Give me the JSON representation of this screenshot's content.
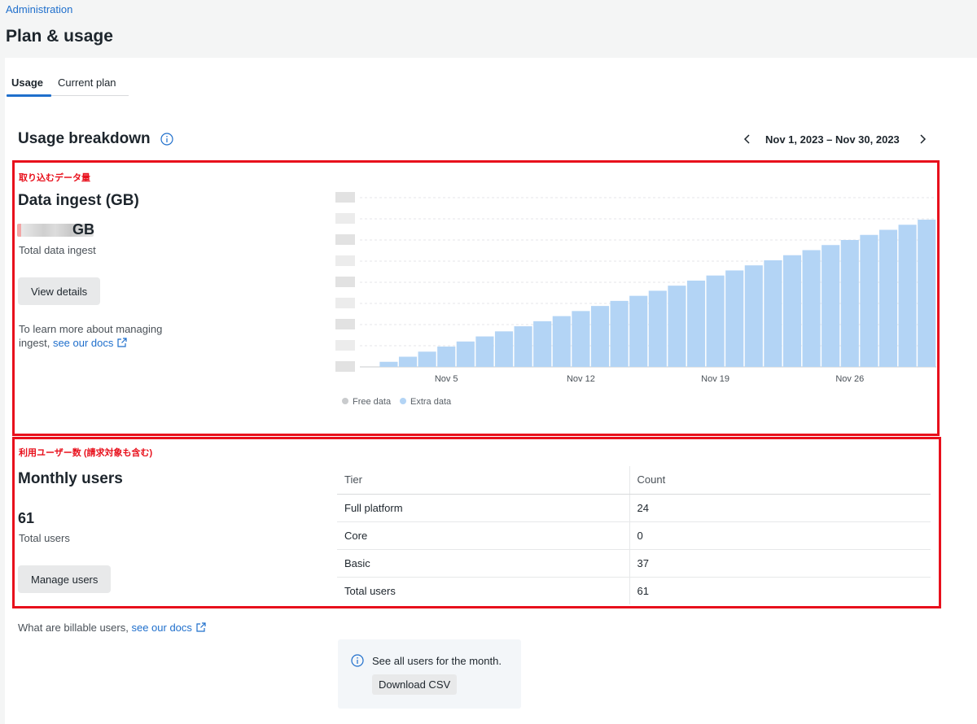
{
  "breadcrumb": "Administration",
  "page_title": "Plan & usage",
  "tabs": [
    {
      "label": "Usage",
      "active": true
    },
    {
      "label": "Current plan",
      "active": false
    }
  ],
  "breakdown": {
    "title": "Usage breakdown",
    "date_range": "Nov 1, 2023 – Nov 30, 2023"
  },
  "annotations": {
    "ingest_note": "取り込むデータ量",
    "users_note": "利用ユーザー数 (請求対象も含む)"
  },
  "ingest": {
    "title": "Data ingest (GB)",
    "value": "",
    "value_redacted": true,
    "unit": "GB",
    "caption": "Total data ingest",
    "button": "View details",
    "help_text": "To learn more about managing ingest,",
    "help_link": "see our docs"
  },
  "chart_data": {
    "type": "bar",
    "categories": [
      "Nov 1",
      "Nov 2",
      "Nov 3",
      "Nov 4",
      "Nov 5",
      "Nov 6",
      "Nov 7",
      "Nov 8",
      "Nov 9",
      "Nov 10",
      "Nov 11",
      "Nov 12",
      "Nov 13",
      "Nov 14",
      "Nov 15",
      "Nov 16",
      "Nov 17",
      "Nov 18",
      "Nov 19",
      "Nov 20",
      "Nov 21",
      "Nov 22",
      "Nov 23",
      "Nov 24",
      "Nov 25",
      "Nov 26",
      "Nov 27",
      "Nov 28",
      "Nov 29",
      "Nov 30"
    ],
    "x_tick_labels": [
      "Nov 5",
      "Nov 12",
      "Nov 19",
      "Nov 26"
    ],
    "series": [
      {
        "name": "Free data",
        "color": "#c9cbcd",
        "values": [
          0,
          0,
          0,
          0,
          0,
          0,
          0,
          0,
          0,
          0,
          0,
          0,
          0,
          0,
          0,
          0,
          0,
          0,
          0,
          0,
          0,
          0,
          0,
          0,
          0,
          0,
          0,
          0,
          0,
          0
        ]
      },
      {
        "name": "Extra data",
        "color": "#b3d4f5",
        "values": [
          0,
          3,
          6,
          9,
          12,
          15,
          18,
          21,
          24,
          27,
          30,
          33,
          36,
          39,
          42,
          45,
          48,
          51,
          54,
          57,
          60,
          63,
          66,
          69,
          72,
          75,
          78,
          81,
          84,
          87
        ]
      }
    ],
    "y_tick_count": 9,
    "ylim": [
      0,
      100
    ],
    "y_tick_labels_redacted": true,
    "grid": true,
    "legend_position": "bottom-left"
  },
  "users": {
    "title": "Monthly users",
    "total": "61",
    "caption": "Total users",
    "button": "Manage users",
    "table": {
      "headers": [
        "Tier",
        "Count"
      ],
      "rows": [
        [
          "Full platform",
          "24"
        ],
        [
          "Core",
          "0"
        ],
        [
          "Basic",
          "37"
        ],
        [
          "Total users",
          "61"
        ]
      ]
    }
  },
  "billable": {
    "text": "What are billable users,",
    "link": "see our docs"
  },
  "csv": {
    "text": "See all users for the month.",
    "button": "Download CSV"
  },
  "colors": {
    "accent": "#1f6fcc",
    "highlight_box": "#e8101c",
    "bar_extra": "#b3d4f5",
    "dot_free": "#c9cbcd"
  }
}
